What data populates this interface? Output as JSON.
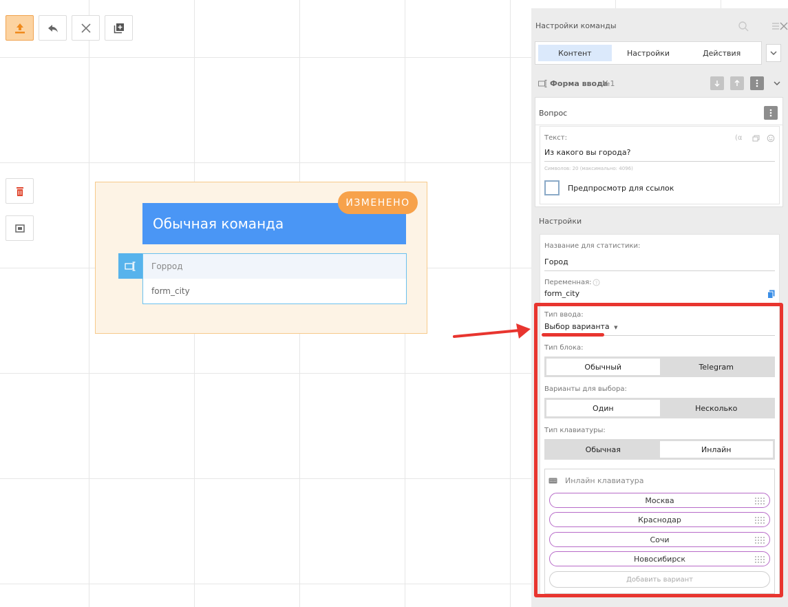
{
  "colors": {
    "accent_orange": "#f7a24b",
    "header_blue": "#4a96f5",
    "input_border": "#69c0ee",
    "annotation_red": "#e8352f",
    "variant_border": "#b76ac8"
  },
  "toolbar": {
    "buttons": [
      {
        "icon": "upload-icon",
        "active": true
      },
      {
        "icon": "undo-icon",
        "active": false
      },
      {
        "icon": "close-icon",
        "active": false
      },
      {
        "icon": "add-block-icon",
        "active": false
      }
    ]
  },
  "side_tools": [
    {
      "icon": "trash-icon"
    },
    {
      "icon": "fit-view-icon"
    }
  ],
  "canvas": {
    "block_title": "Обычная команда",
    "badge": "ИЗМЕНЕНО",
    "input_name": "Горрод",
    "input_variable": "form_city"
  },
  "panel": {
    "title": "Настройки команды",
    "tabs": [
      "Контент",
      "Настройки",
      "Действия"
    ],
    "active_tab": "Контент",
    "form_title": "Форма ввода",
    "form_number": "№1",
    "question_section": "Вопрос",
    "text_label": "Текст:",
    "text_value": "Из какого вы города?",
    "char_count": "Символов: 20 (максимально: 4096)",
    "preview_links": "Предпросмотр для ссылок",
    "settings_section": "Настройки",
    "stat_name_label": "Название для статистики:",
    "stat_name_value": "Город",
    "variable_label": "Переменная:",
    "variable_value": "form_city",
    "input_type_label": "Тип ввода:",
    "input_type_value": "Выбор варианта",
    "block_type_label": "Тип блока:",
    "block_type_options": [
      "Обычный",
      "Telegram"
    ],
    "choice_label": "Варианты для выбора:",
    "choice_options": [
      "Один",
      "Несколько"
    ],
    "keyboard_label": "Тип клавиатуры:",
    "keyboard_options": [
      "Обычная",
      "Инлайн"
    ],
    "inline_title": "Инлайн клавиатура",
    "variants": [
      "Москва",
      "Краснодар",
      "Сочи",
      "Новосибирск"
    ],
    "add_variant": "Добавить вариант"
  }
}
